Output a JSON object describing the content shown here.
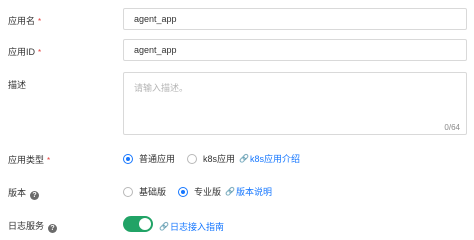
{
  "form": {
    "app_name": {
      "label": "应用名",
      "required_mark": "*",
      "value": "agent_app"
    },
    "app_id": {
      "label": "应用ID",
      "required_mark": "*",
      "value": "agent_app"
    },
    "description": {
      "label": "描述",
      "placeholder": "请输入描述。",
      "counter": "0/64"
    },
    "app_type": {
      "label": "应用类型",
      "required_mark": "*",
      "options": [
        "普通应用",
        "k8s应用"
      ],
      "selected": "普通应用",
      "link": "k8s应用介绍"
    },
    "version": {
      "label": "版本",
      "help_icon": "question-circle-icon",
      "options": [
        "基础版",
        "专业版"
      ],
      "selected": "专业版",
      "link": "版本说明"
    },
    "log_service": {
      "label": "日志服务",
      "help_icon": "question-circle-icon",
      "enabled": true,
      "link": "日志接入指南"
    }
  },
  "colors": {
    "primary": "#1677ff",
    "toggle_on": "#21a366",
    "required": "#e23c39"
  }
}
